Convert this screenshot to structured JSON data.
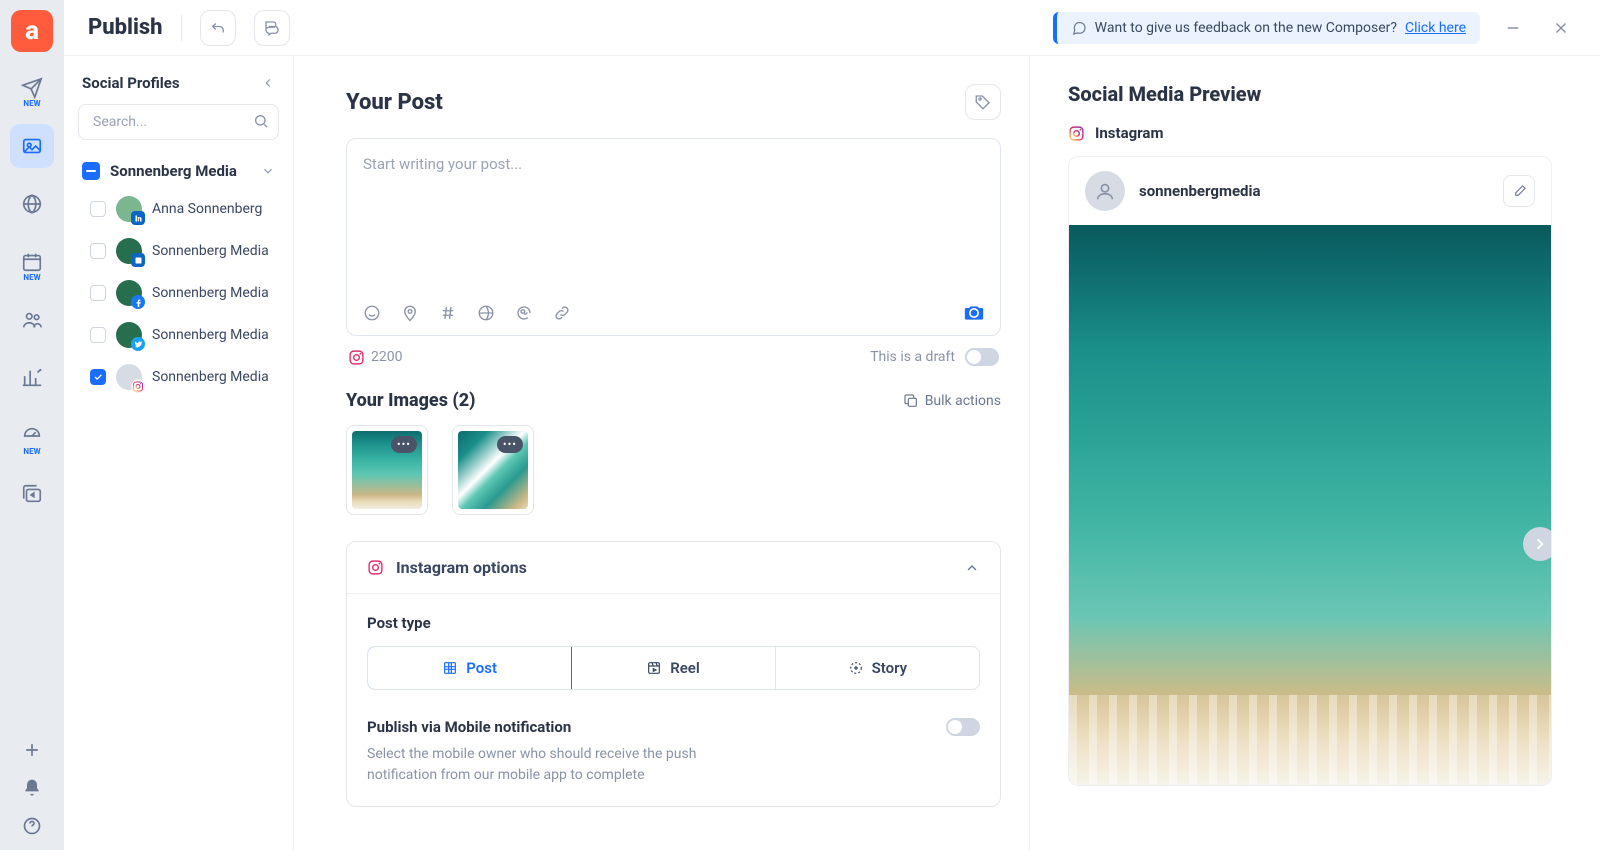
{
  "topbar": {
    "title": "Publish",
    "feedback_text": "Want to give us feedback on the new Composer? ",
    "feedback_link": "Click here"
  },
  "rail": {
    "new_badge": "NEW"
  },
  "profiles": {
    "title": "Social Profiles",
    "search_placeholder": "Search...",
    "group": {
      "name": "Sonnenberg Media"
    },
    "accounts": [
      {
        "name": "Anna Sonnenberg",
        "network": "linkedin",
        "checked": false
      },
      {
        "name": "Sonnenberg Media",
        "network": "linkedin-co",
        "checked": false
      },
      {
        "name": "Sonnenberg Media",
        "network": "facebook",
        "checked": false
      },
      {
        "name": "Sonnenberg Media",
        "network": "twitter",
        "checked": false
      },
      {
        "name": "Sonnenberg Media",
        "network": "instagram",
        "checked": true
      }
    ]
  },
  "composer": {
    "title": "Your Post",
    "placeholder": "Start writing your post...",
    "char_count": "2200",
    "draft_label": "This is a draft",
    "images_title": "Your Images (2)",
    "bulk_label": "Bulk actions",
    "options_title": "Instagram options",
    "post_type_label": "Post type",
    "post_types": {
      "post": "Post",
      "reel": "Reel",
      "story": "Story"
    },
    "mobile_title": "Publish via Mobile notification",
    "mobile_desc": "Select the mobile owner who should receive the push notification from our mobile app to complete"
  },
  "preview": {
    "title": "Social Media Preview",
    "platform": "Instagram",
    "username": "sonnenbergmedia"
  }
}
